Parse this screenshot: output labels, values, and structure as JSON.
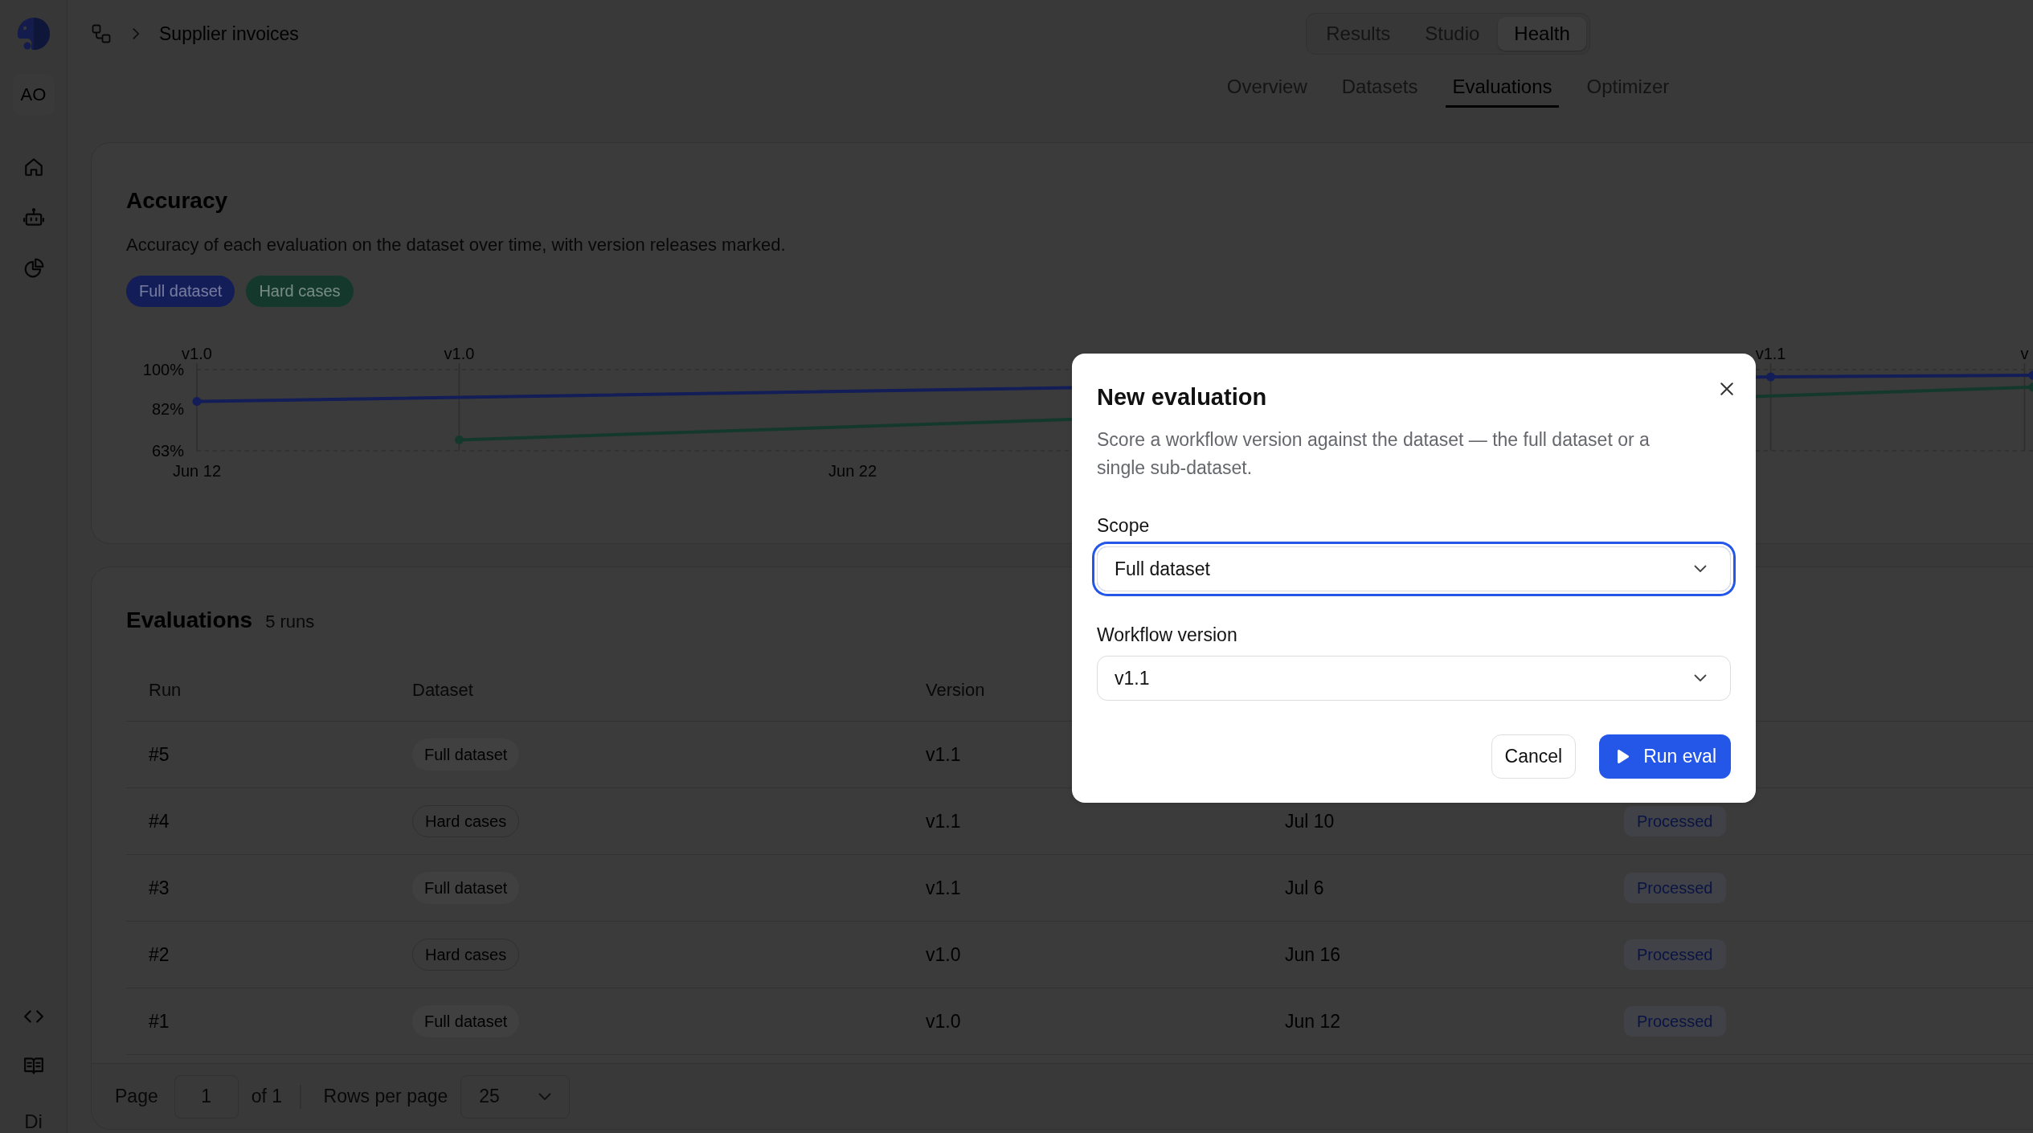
{
  "sidebar": {
    "avatar": "AO",
    "footer_label": "Di"
  },
  "breadcrumb": {
    "current": "Supplier invoices"
  },
  "mode_tabs": [
    {
      "label": "Results",
      "selected": false
    },
    {
      "label": "Studio",
      "selected": false
    },
    {
      "label": "Health",
      "selected": true
    }
  ],
  "tabs": [
    {
      "label": "Overview",
      "selected": false
    },
    {
      "label": "Datasets",
      "selected": false
    },
    {
      "label": "Evaluations",
      "selected": true
    },
    {
      "label": "Optimizer",
      "selected": false
    }
  ],
  "accuracy_card": {
    "title": "Accuracy",
    "description": "Accuracy of each evaluation on the dataset over time, with version releases marked.",
    "chart_data": {
      "type": "line",
      "grid": true,
      "categories": [
        "Jun 12",
        null,
        null,
        null,
        null,
        null,
        null,
        null,
        null,
        null,
        "Jun 22",
        null,
        null,
        null,
        null,
        null,
        null,
        null,
        null,
        null,
        null,
        null,
        null,
        null,
        null,
        null,
        null,
        null,
        null
      ],
      "ylim": [
        63,
        100
      ],
      "yticks": [
        {
          "value": 100,
          "label": "100%"
        },
        {
          "value": 82,
          "label": "82%"
        },
        {
          "value": 63,
          "label": "63%"
        }
      ],
      "series": [
        {
          "name": "Full dataset",
          "color": "#131d58",
          "marker": "circle",
          "values": [
            85.5,
            null,
            null,
            null,
            null,
            null,
            null,
            null,
            null,
            null,
            null,
            null,
            null,
            null,
            null,
            null,
            null,
            null,
            null,
            null,
            null,
            null,
            null,
            null,
            96.7,
            null,
            null,
            null,
            97.4
          ]
        },
        {
          "name": "Hard cases",
          "color": "#15382d",
          "marker": "circle",
          "values": [
            null,
            null,
            null,
            null,
            68,
            null,
            null,
            null,
            null,
            null,
            null,
            null,
            null,
            null,
            null,
            null,
            null,
            null,
            null,
            null,
            null,
            null,
            null,
            null,
            null,
            null,
            null,
            null,
            92
          ]
        }
      ],
      "annotations": [
        "v1.0",
        "v1.0",
        "v1.1",
        "v"
      ]
    }
  },
  "evaluations_card": {
    "title": "Evaluations",
    "count": "5 runs",
    "table": {
      "columns": [
        "Run",
        "Dataset",
        "Version"
      ],
      "rows": [
        {
          "run": "#5",
          "dataset": {
            "label": "Full dataset",
            "kind": "filled"
          },
          "version": "v1.1"
        },
        {
          "run": "#4",
          "dataset": {
            "label": "Hard cases",
            "kind": "outlined"
          },
          "version": "v1.1",
          "column_4": "Jul 10",
          "column_5": "Processed"
        },
        {
          "run": "#3",
          "dataset": {
            "label": "Full dataset",
            "kind": "filled"
          },
          "version": "v1.1",
          "column_4": "Jul 6",
          "column_5": "Processed"
        },
        {
          "run": "#2",
          "dataset": {
            "label": "Hard cases",
            "kind": "outlined"
          },
          "version": "v1.0",
          "column_4": "Jun 16",
          "column_5": "Processed"
        },
        {
          "run": "#1",
          "dataset": {
            "label": "Full dataset",
            "kind": "filled"
          },
          "version": "v1.0",
          "column_4": "Jun 12",
          "column_5": "Processed"
        }
      ]
    },
    "pagination": {
      "page_label": "Page",
      "page": "1",
      "page_count": "of 1",
      "rows_per_page_label": "Rows per page",
      "rows_per_page": "25"
    }
  },
  "modal": {
    "title": "New evaluation",
    "description": "Score a workflow version against the dataset — the full dataset or a single sub-dataset.",
    "fields": [
      {
        "label": "Scope",
        "value": "Full dataset",
        "focused": true
      },
      {
        "label": "Workflow version",
        "value": "v1.1",
        "focused": false
      }
    ],
    "buttons": [
      {
        "label": "Cancel",
        "kind": "secondary"
      },
      {
        "label": "Run eval",
        "kind": "primary"
      }
    ]
  }
}
